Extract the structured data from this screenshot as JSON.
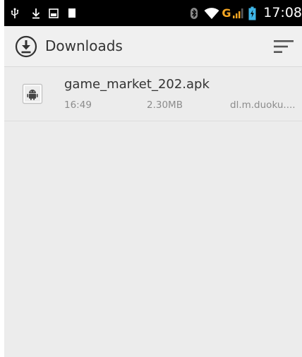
{
  "status_bar": {
    "time": "17:08",
    "icons": [
      "usb-icon",
      "download-icon",
      "image-icon",
      "sd-card-icon",
      "bluetooth-icon",
      "wifi-icon",
      "g-network-icon",
      "signal-icon",
      "battery-icon"
    ],
    "network_label": "G",
    "accent_color": "#f5a623",
    "battery_color": "#3fb6e8"
  },
  "action_bar": {
    "title": "Downloads",
    "icons": [
      "downloads-icon",
      "sort-icon"
    ]
  },
  "downloads": [
    {
      "name": "game_market_202.apk",
      "time": "16:49",
      "size": "2.30MB",
      "source": "dl.m.duoku....",
      "icon": "android-package-icon"
    }
  ]
}
